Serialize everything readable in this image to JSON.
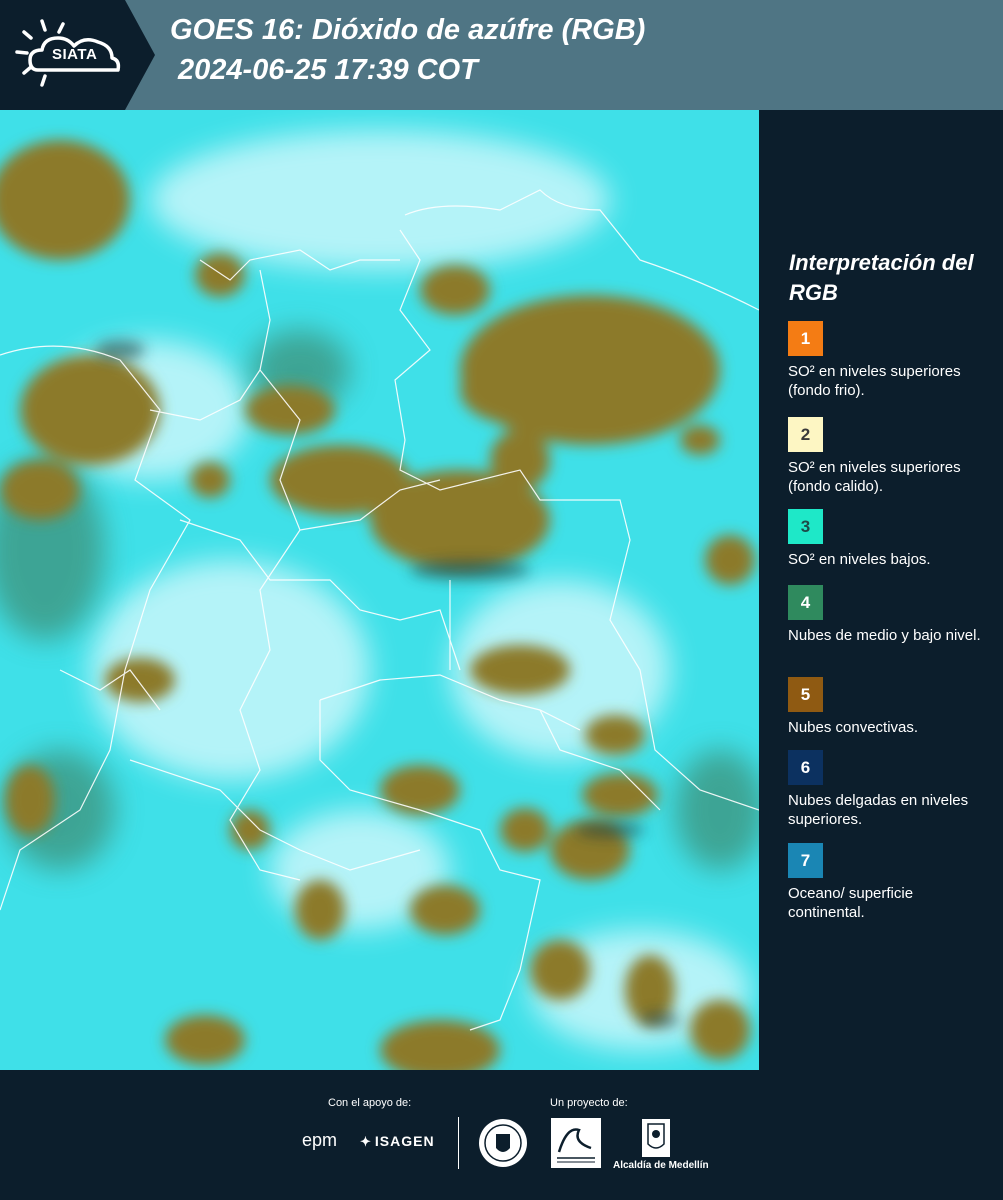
{
  "header": {
    "logo_text": "SIATA",
    "title_line1": "GOES 16: Dióxido de azúfre (RGB)",
    "title_line2": "2024-06-25 17:39 COT"
  },
  "legend": {
    "title": "Interpretación del RGB",
    "items": [
      {
        "number": "1",
        "color": "#f47c14",
        "text": "SO² en niveles superiores (fondo frio)."
      },
      {
        "number": "2",
        "color": "#fdf6c3",
        "text": "SO² en niveles superiores (fondo calido)."
      },
      {
        "number": "3",
        "color": "#1ee8c8",
        "text": "SO² en niveles bajos."
      },
      {
        "number": "4",
        "color": "#2f8a5e",
        "text": "Nubes de medio y bajo nivel."
      },
      {
        "number": "5",
        "color": "#8f5a12",
        "text": "Nubes convectivas."
      },
      {
        "number": "6",
        "color": "#0c3160",
        "text": "Nubes delgadas en niveles superiores."
      },
      {
        "number": "7",
        "color": "#1a86b4",
        "text": "Oceano/ superficie continental."
      }
    ]
  },
  "footer": {
    "support_label": "Con el apoyo de:",
    "project_label": "Un proyecto de:",
    "sponsors": [
      "epm",
      "ISAGEN"
    ],
    "alcaldia_label": "Alcaldía de Medellín"
  },
  "colors": {
    "header_bg": "#4f7584",
    "panel_bg": "#0c1e2c",
    "map_base": "#2ee0e6",
    "cloud_brown": "#8a7a2a",
    "border_line": "#ffffff"
  }
}
